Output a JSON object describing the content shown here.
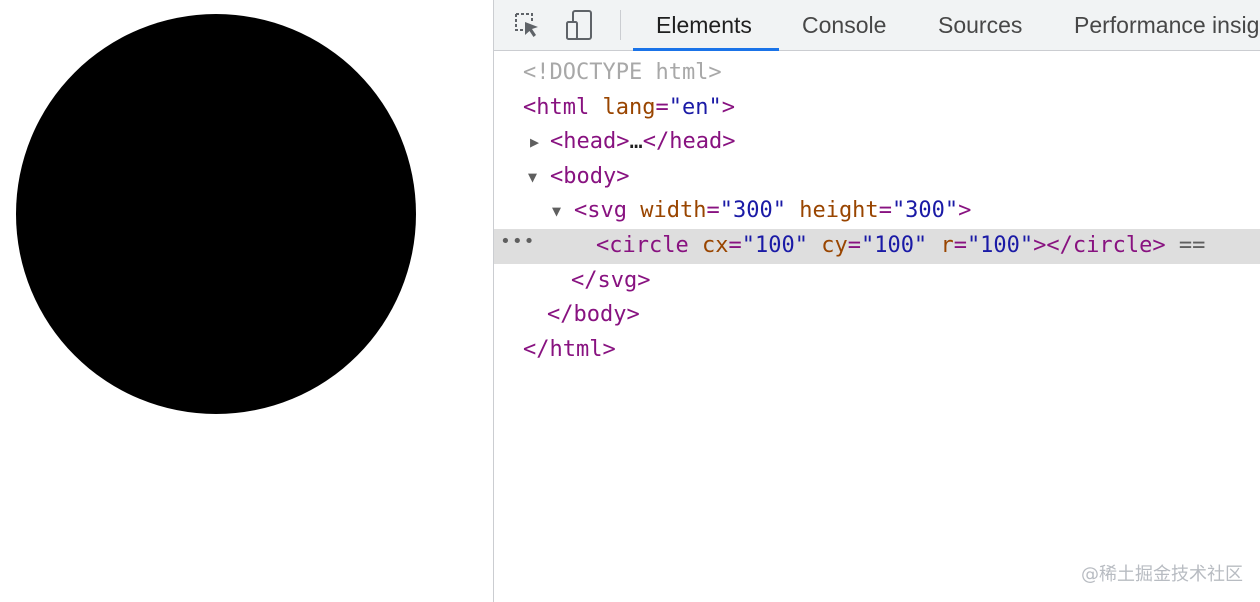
{
  "viewport": {
    "circle_color": "#000000"
  },
  "toolbar": {
    "inspect_icon": "inspect-cursor-icon",
    "device_icon": "device-toggle-icon",
    "tabs": [
      {
        "label": "Elements",
        "active": true
      },
      {
        "label": "Console",
        "active": false
      },
      {
        "label": "Sources",
        "active": false
      },
      {
        "label": "Performance insig",
        "active": false
      }
    ],
    "accent_color": "#1a73e8"
  },
  "tree": {
    "doctype": "<!DOCTYPE html>",
    "html_open": {
      "tag": "<html",
      "attr": "lang",
      "eq": "=",
      "val": "\"en\"",
      "close": ">"
    },
    "head": {
      "open": "<head>",
      "ellipsis": "…",
      "close": "</head>"
    },
    "body_open": "<body>",
    "svg_open": {
      "tag": "<svg",
      "attr1": "width",
      "val1": "\"300\"",
      "attr2": "height",
      "val2": "\"300\"",
      "close": ">"
    },
    "circle": {
      "tag": "<circle",
      "attr1": "cx",
      "val1": "\"100\"",
      "attr2": "cy",
      "val2": "\"100\"",
      "attr3": "r",
      "val3": "\"100\"",
      "close": "></circle>",
      "suffix": "=="
    },
    "svg_close": "</svg>",
    "body_close": "</body>",
    "html_close": "</html>",
    "row_menu_dots": "•••"
  },
  "watermark": "@稀土掘金技术社区"
}
